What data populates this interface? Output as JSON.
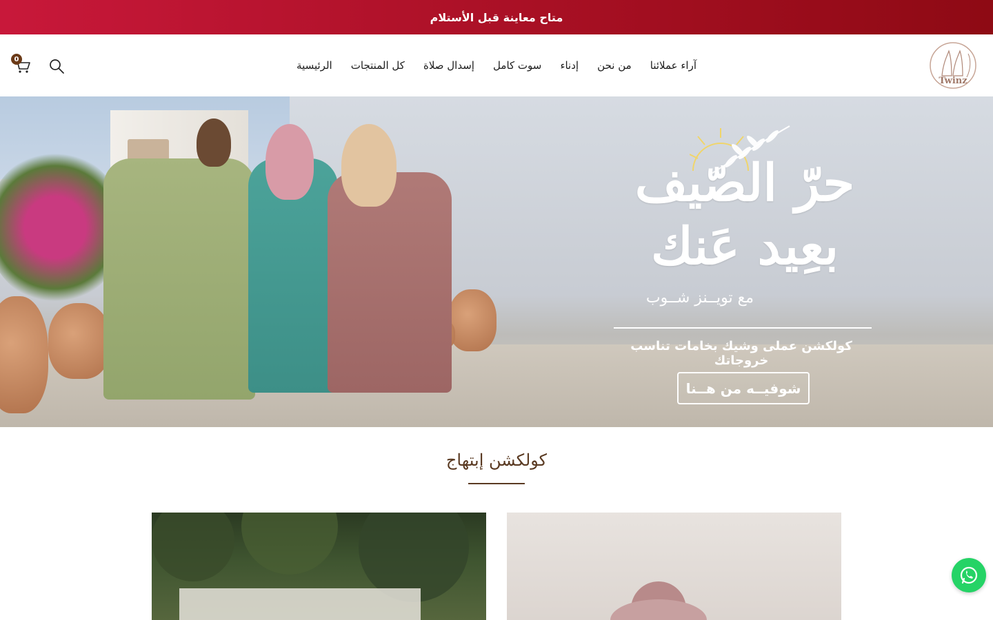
{
  "announcement": {
    "text": "متاح معاينة قبل الأستلام"
  },
  "brand": {
    "logo_text": "Twinz"
  },
  "nav": {
    "items": [
      {
        "label": "الرئيسية"
      },
      {
        "label": "كل المنتجات"
      },
      {
        "label": "إسدال صلاة"
      },
      {
        "label": "سوت كامل"
      },
      {
        "label": "إدناء"
      },
      {
        "label": "من نحن"
      },
      {
        "label": "آراء عملائنا"
      }
    ]
  },
  "header_icons": {
    "search": "search-icon",
    "cart": "cart-icon",
    "cart_count": "0"
  },
  "hero": {
    "title_line1": "حرّ الصّيف",
    "title_line2": "بعِيد عَنك",
    "subtitle": "مع تويــنز شــوب",
    "caption": "كولكشن عملى وشيك بخامات تناسب خروجاتك",
    "cta_label": "شوفيــه من هــنا"
  },
  "collection": {
    "title": "كولكشن إبتهاج"
  },
  "colors": {
    "announcement": "#a50f22",
    "accent_brown": "#5a3a22",
    "whatsapp": "#25d366"
  },
  "floating": {
    "whatsapp": "whatsapp-icon"
  }
}
